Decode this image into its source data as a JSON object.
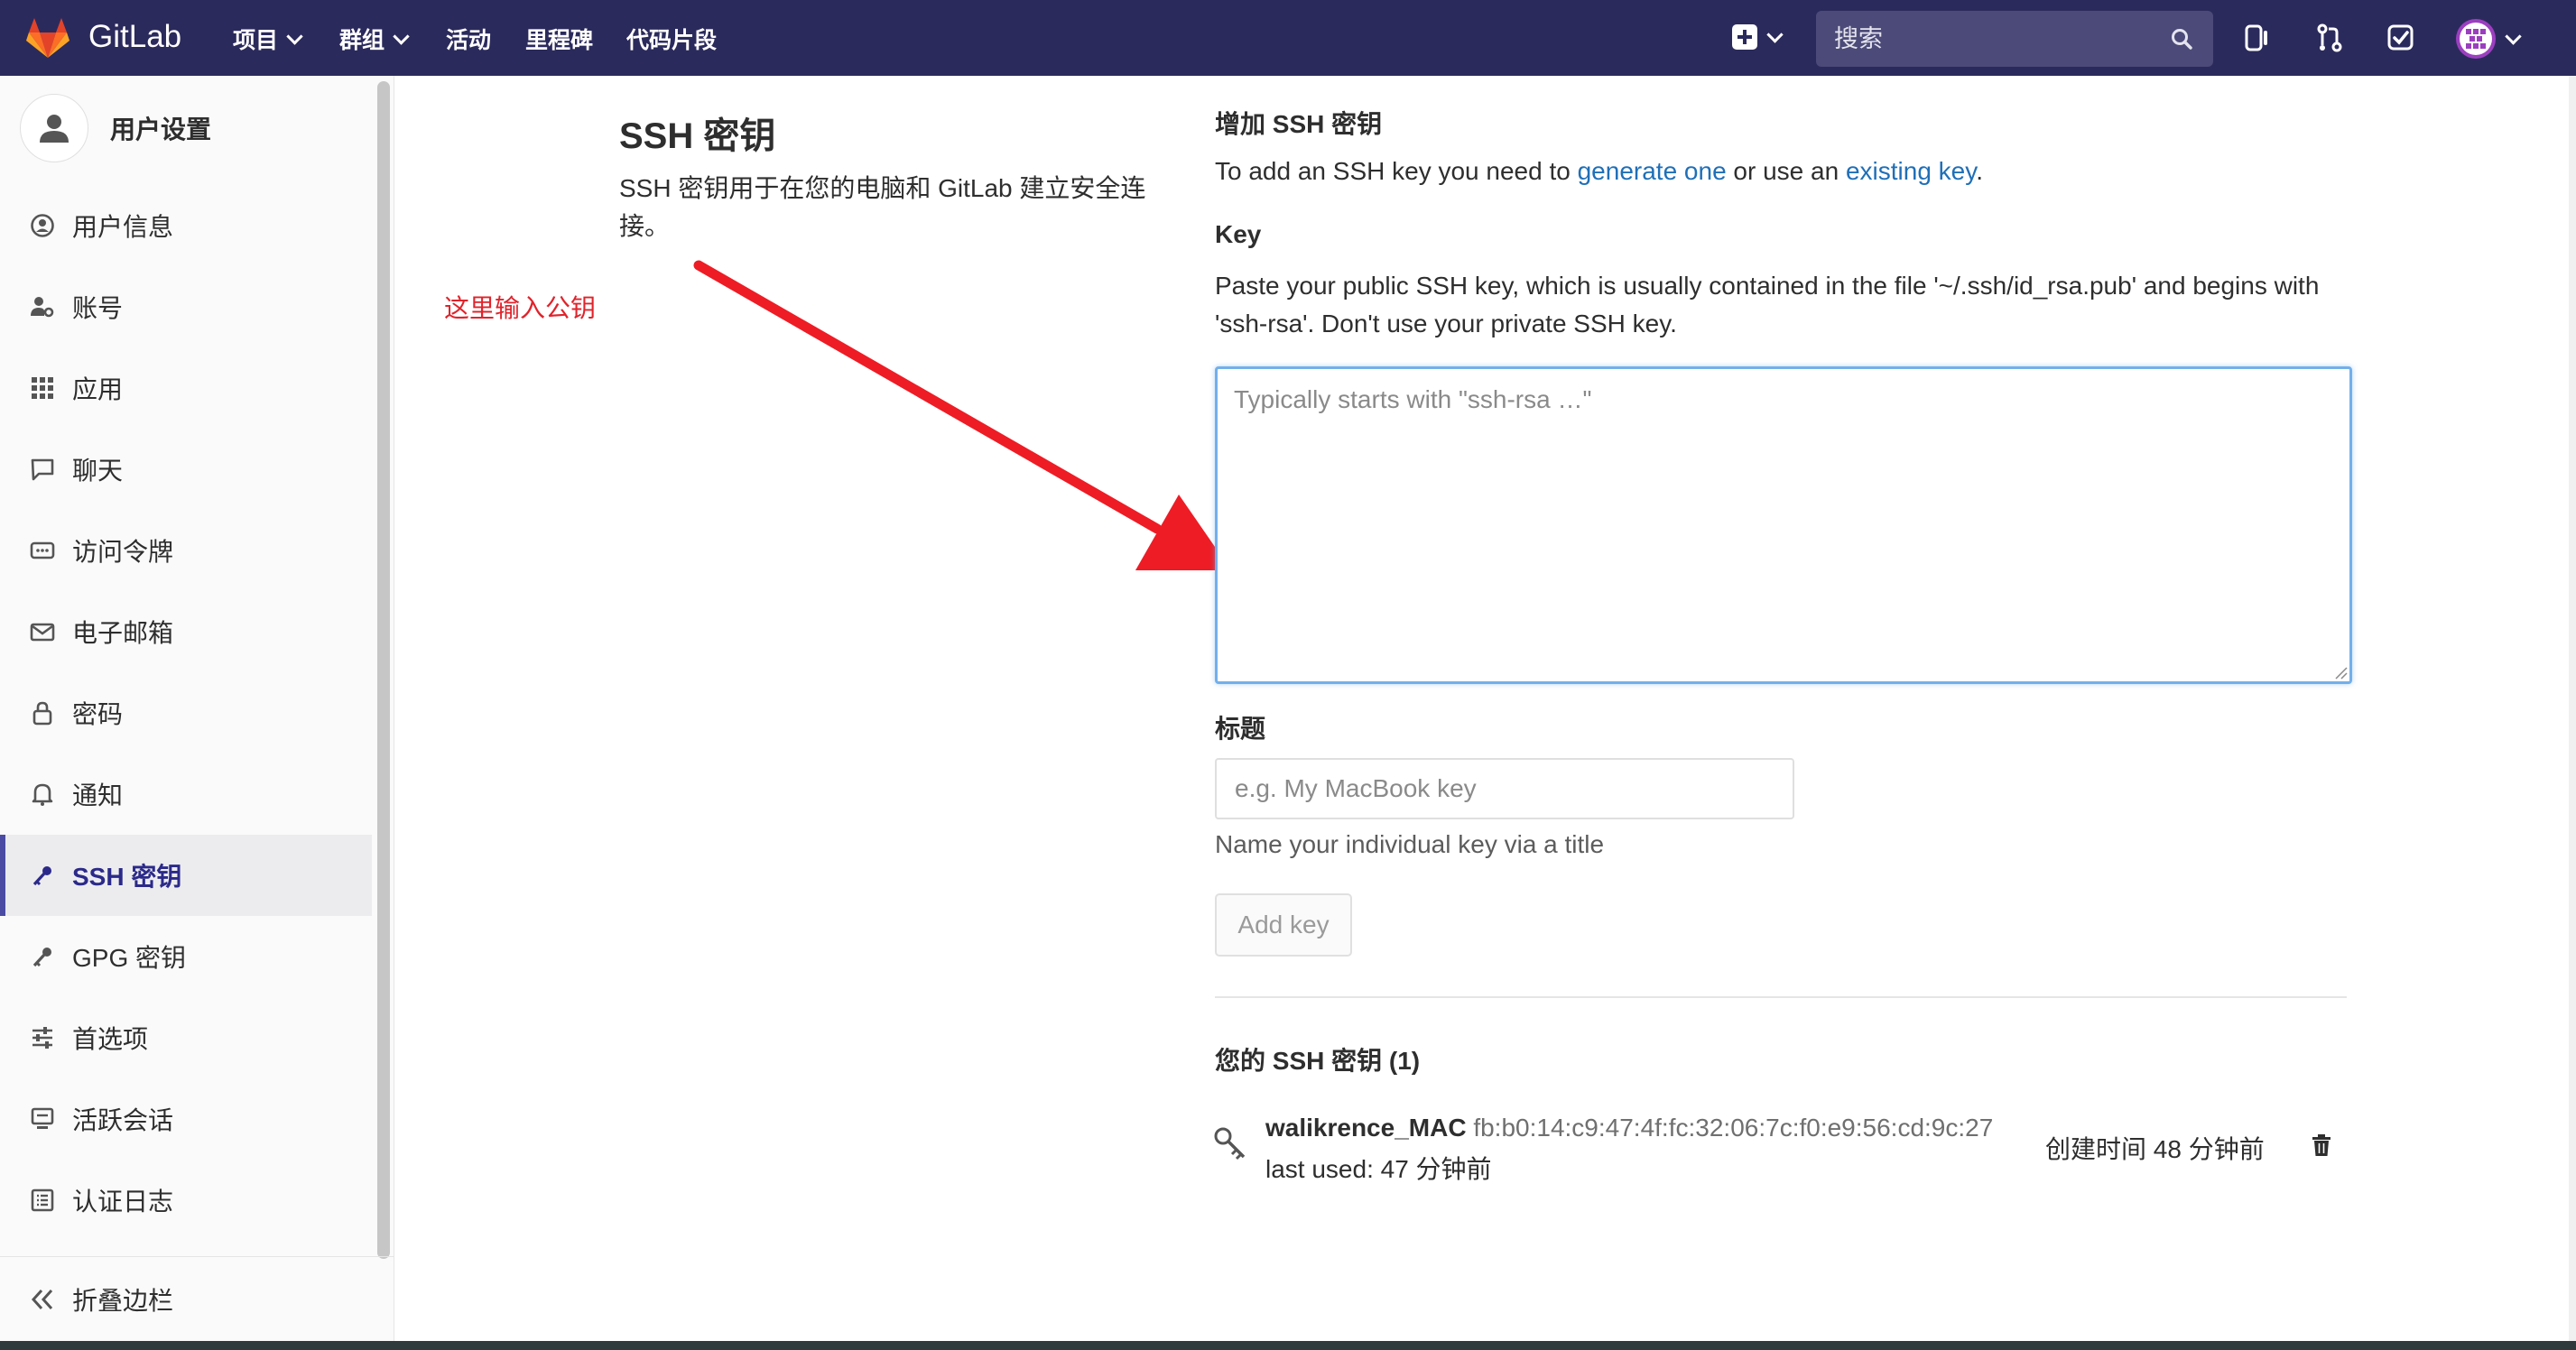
{
  "navbar": {
    "brand": "GitLab",
    "links": [
      "项目",
      "群组",
      "活动",
      "里程碑",
      "代码片段"
    ],
    "search_placeholder": "搜索"
  },
  "sidebar": {
    "title": "用户设置",
    "items": [
      {
        "label": "用户信息",
        "icon": "profile-icon"
      },
      {
        "label": "账号",
        "icon": "account-icon"
      },
      {
        "label": "应用",
        "icon": "applications-icon"
      },
      {
        "label": "聊天",
        "icon": "chat-icon"
      },
      {
        "label": "访问令牌",
        "icon": "token-icon"
      },
      {
        "label": "电子邮箱",
        "icon": "mail-icon"
      },
      {
        "label": "密码",
        "icon": "lock-icon"
      },
      {
        "label": "通知",
        "icon": "bell-icon"
      },
      {
        "label": "SSH 密钥",
        "icon": "key-icon"
      },
      {
        "label": "GPG 密钥",
        "icon": "key-icon"
      },
      {
        "label": "首选项",
        "icon": "preferences-icon"
      },
      {
        "label": "活跃会话",
        "icon": "monitor-icon"
      },
      {
        "label": "认证日志",
        "icon": "log-icon"
      }
    ],
    "active_index": 8,
    "collapse_label": "折叠边栏"
  },
  "page": {
    "title": "SSH 密钥",
    "description": "SSH 密钥用于在您的电脑和 GitLab 建立安全连接。",
    "annotation": "这里输入公钥"
  },
  "add_form": {
    "heading": "增加 SSH 密钥",
    "intro_prefix": "To add an SSH key you need to ",
    "intro_link1": "generate one",
    "intro_middle": " or use an ",
    "intro_link2": "existing key",
    "intro_suffix": ".",
    "key_label": "Key",
    "key_help": "Paste your public SSH key, which is usually contained in the file '~/.ssh/id_rsa.pub' and begins with 'ssh-rsa'. Don't use your private SSH key.",
    "key_placeholder": "Typically starts with \"ssh-rsa …\"",
    "title_label": "标题",
    "title_placeholder": "e.g. My MacBook key",
    "title_help": "Name your individual key via a title",
    "add_button": "Add key"
  },
  "keys": {
    "heading": "您的 SSH 密钥 (1)",
    "items": [
      {
        "name": "walikrence_MAC",
        "fingerprint": "fb:b0:14:c9:47:4f:fc:32:06:7c:f0:e9:56:cd:9c:27",
        "last_used": "last used: 47 分钟前",
        "created": "创建时间 48 分钟前"
      }
    ]
  },
  "colors": {
    "navbar_bg": "#2b2a5c",
    "link": "#1f6fb8",
    "annotation": "#e0232b",
    "focus_border": "#73afea"
  }
}
